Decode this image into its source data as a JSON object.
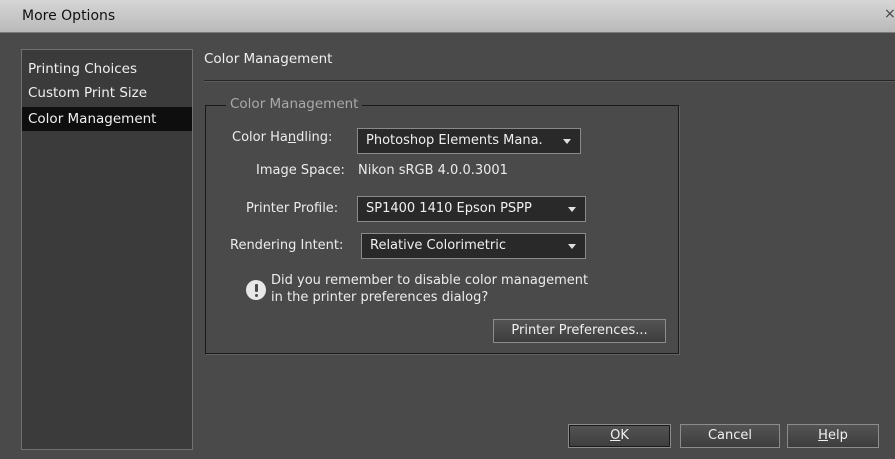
{
  "window": {
    "title": "More Options",
    "close_glyph": "×"
  },
  "sidebar": {
    "items": [
      {
        "label": "Printing Choices"
      },
      {
        "label": "Custom Print Size"
      },
      {
        "label": "Color Management",
        "selected": true
      }
    ]
  },
  "main": {
    "section_title": "Color Management",
    "group_legend": "Color Management",
    "color_handling": {
      "label_pre": "Color Ha",
      "label_mnemonic": "n",
      "label_post": "dling:",
      "value": "Photoshop Elements Mana."
    },
    "image_space": {
      "label": "Image Space:",
      "value": "Nikon sRGB 4.0.0.3001"
    },
    "printer_profile": {
      "label": "Printer Profile:",
      "value": "SP1400 1410 Epson PSPP"
    },
    "rendering_intent": {
      "label": "Rendering Intent:",
      "value": "Relative Colorimetric"
    },
    "notice": {
      "icon": "exclamation-icon",
      "line1": "Did you remember to disable color management",
      "line2": "in the printer preferences dialog?"
    },
    "printer_preferences_label": "Printer Preferences..."
  },
  "buttons": {
    "ok": {
      "mnemonic": "O",
      "rest": "K"
    },
    "cancel": "Cancel",
    "help": {
      "mnemonic": "H",
      "rest": "elp"
    }
  }
}
